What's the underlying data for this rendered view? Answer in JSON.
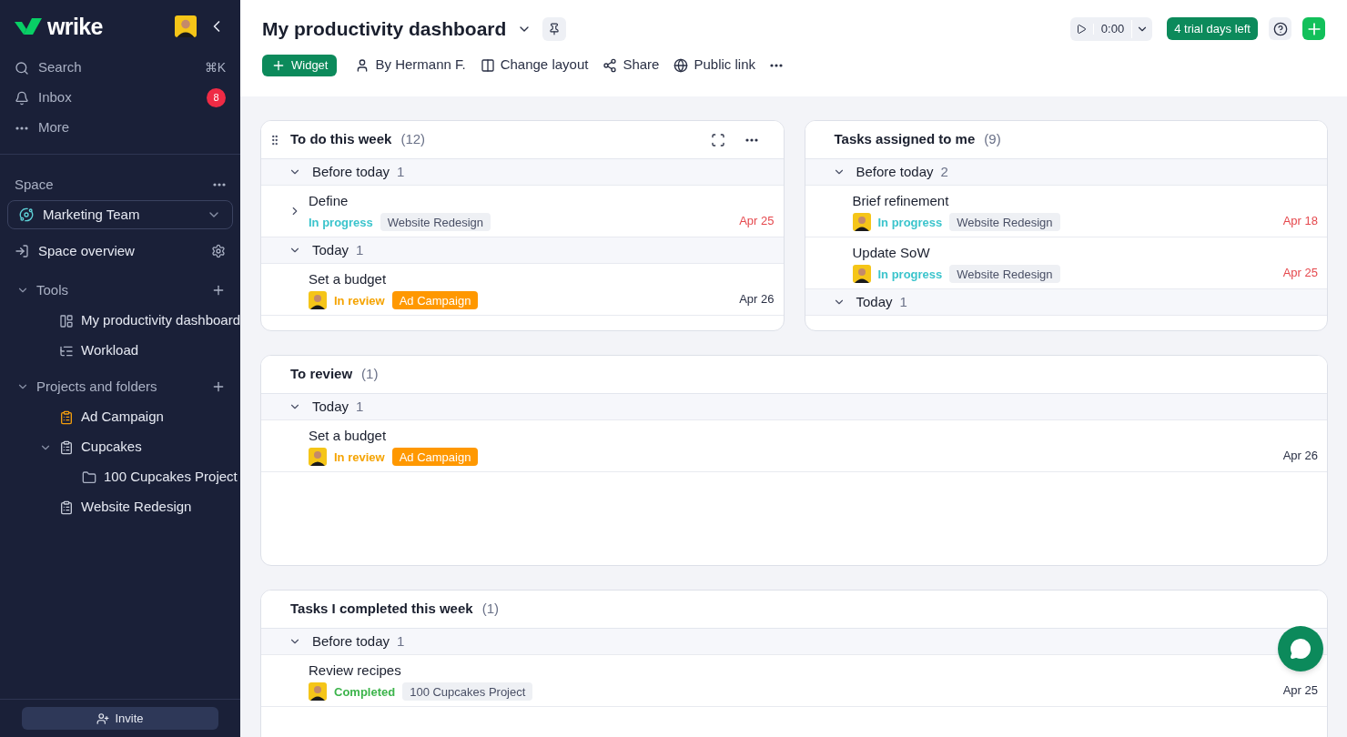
{
  "sidebar": {
    "logo": "wrike",
    "nav": [
      {
        "kind": "search",
        "label": "Search",
        "shortcut": "⌘K"
      },
      {
        "kind": "inbox",
        "label": "Inbox",
        "badge": "8"
      },
      {
        "kind": "more",
        "label": "More"
      }
    ],
    "space": {
      "label": "Space",
      "selector": "Marketing Team",
      "overview": "Space overview"
    },
    "sections": [
      {
        "label": "Tools",
        "expanded": true,
        "children": [
          {
            "label": "My productivity dashboard",
            "kind": "dashboard"
          },
          {
            "label": "Workload",
            "kind": "workload"
          }
        ]
      },
      {
        "label": "Projects and folders",
        "expanded": true,
        "children": [
          {
            "label": "Ad Campaign",
            "kind": "project",
            "color": "#f29d0c"
          },
          {
            "label": "Cupcakes",
            "kind": "project",
            "color": "#c5cad8",
            "expanded": true,
            "children": [
              {
                "label": "100 Cupcakes Project",
                "kind": "folder"
              }
            ]
          },
          {
            "label": "Website Redesign",
            "kind": "project",
            "color": "#c5cad8"
          }
        ]
      }
    ],
    "invite": "Invite"
  },
  "header": {
    "title": "My productivity dashboard",
    "timer": "0:00",
    "trial": "4 trial days left",
    "toolbar": [
      {
        "kind": "widget",
        "label": "Widget"
      },
      {
        "kind": "owner",
        "label": "By Hermann F."
      },
      {
        "kind": "layout",
        "label": "Change layout"
      },
      {
        "kind": "share",
        "label": "Share"
      },
      {
        "kind": "public",
        "label": "Public link"
      }
    ]
  },
  "widgets": [
    {
      "title": "To do this week",
      "count": "(12)",
      "controls": true,
      "groups": [
        {
          "label": "Before today",
          "count": "1",
          "expanded": true,
          "tasks": [
            {
              "name": "Define",
              "expandable": true,
              "avatar": false,
              "status": {
                "label": "In progress",
                "kind": "progress"
              },
              "tag": {
                "label": "Website Redesign",
                "color": "#eef0f4"
              },
              "date": {
                "text": "Apr 25",
                "overdue": true
              }
            }
          ]
        },
        {
          "label": "Today",
          "count": "1",
          "expanded": true,
          "tasks": [
            {
              "name": "Set a budget",
              "expandable": false,
              "avatar": true,
              "status": {
                "label": "In review",
                "kind": "review"
              },
              "tag": {
                "label": "Ad Campaign",
                "color": "#ff9800"
              },
              "date": {
                "text": "Apr 26",
                "overdue": false
              }
            }
          ]
        }
      ]
    },
    {
      "title": "Tasks assigned to me",
      "count": "(9)",
      "controls": false,
      "groups": [
        {
          "label": "Before today",
          "count": "2",
          "expanded": true,
          "tasks": [
            {
              "name": "Brief refinement",
              "expandable": false,
              "avatar": true,
              "status": {
                "label": "In progress",
                "kind": "progress"
              },
              "tag": {
                "label": "Website Redesign",
                "color": "#eef0f4"
              },
              "date": {
                "text": "Apr 18",
                "overdue": true
              }
            },
            {
              "name": "Update SoW",
              "expandable": false,
              "avatar": true,
              "status": {
                "label": "In progress",
                "kind": "progress"
              },
              "tag": {
                "label": "Website Redesign",
                "color": "#eef0f4"
              },
              "date": {
                "text": "Apr 25",
                "overdue": true
              }
            }
          ]
        },
        {
          "label": "Today",
          "count": "1",
          "expanded": true
        }
      ]
    },
    {
      "title": "To review",
      "count": "(1)",
      "controls": false,
      "groups": [
        {
          "label": "Today",
          "count": "1",
          "expanded": true,
          "tasks": [
            {
              "name": "Set a budget",
              "expandable": false,
              "avatar": true,
              "status": {
                "label": "In review",
                "kind": "review"
              },
              "tag": {
                "label": "Ad Campaign",
                "color": "#ff9800"
              },
              "date": {
                "text": "Apr 26",
                "overdue": false
              }
            }
          ]
        }
      ]
    },
    {
      "title": "Tasks I completed this week",
      "count": "(1)",
      "controls": false,
      "groups": [
        {
          "label": "Before today",
          "count": "1",
          "expanded": true,
          "tasks": [
            {
              "name": "Review recipes",
              "expandable": false,
              "avatar": true,
              "status": {
                "label": "Completed",
                "kind": "completed"
              },
              "tag": {
                "label": "100 Cupcakes Project",
                "color": "#eef0f4"
              },
              "date": {
                "text": "Apr 25",
                "overdue": false
              }
            }
          ]
        }
      ]
    }
  ]
}
